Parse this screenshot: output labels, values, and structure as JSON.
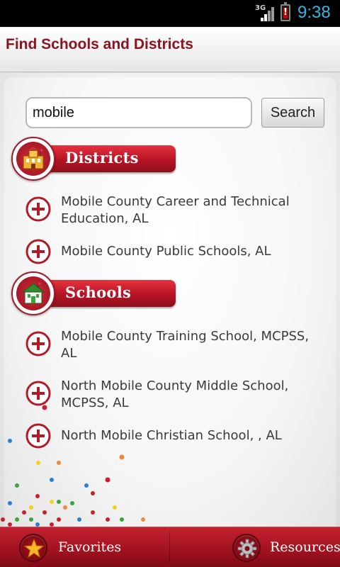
{
  "status_bar": {
    "network": "3G",
    "battery_mark": "!",
    "time": "9:38",
    "time_color": "#33b5e5"
  },
  "header": {
    "title": "Find Schools and Districts"
  },
  "search": {
    "value": "mobile",
    "button_label": "Search"
  },
  "districts": {
    "label": "Districts",
    "icon": "district-building-icon",
    "items": [
      "Mobile County Career and Technical Education, AL",
      "Mobile County Public Schools, AL"
    ]
  },
  "schools": {
    "label": "Schools",
    "icon": "school-house-icon",
    "items": [
      "Mobile County Training School, MCPSS, AL",
      "North Mobile County Middle School, MCPSS, AL",
      "North Mobile Christian School, , AL"
    ]
  },
  "bottom_bar": {
    "favorites_label": "Favorites",
    "favorites_icon": "star-icon",
    "resources_label": "Resources",
    "resources_icon": "gear-icon"
  },
  "colors": {
    "brand_red": "#a51320",
    "title_red": "#8a1421",
    "item_text": "#3a3a3a"
  }
}
